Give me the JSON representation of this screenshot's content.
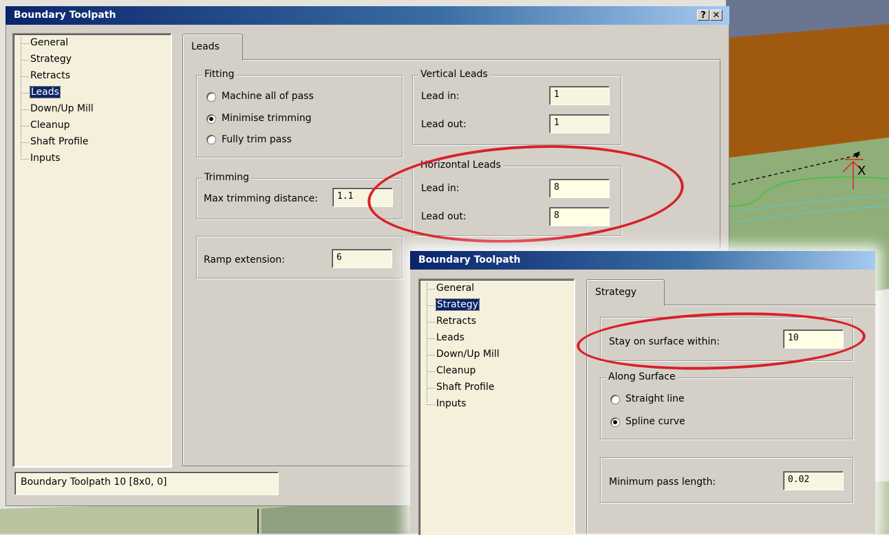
{
  "colors": {
    "titlebar": "#0a246a",
    "highlight": "#d8202a",
    "field_bg": "#f7f5e0",
    "dialog_bg": "#d4d0c8"
  },
  "main_dialog": {
    "title": "Boundary Toolpath",
    "help_button": "?",
    "close_button": "✕",
    "tree": [
      "General",
      "Strategy",
      "Retracts",
      "Leads",
      "Down/Up Mill",
      "Cleanup",
      "Shaft Profile",
      "Inputs"
    ],
    "selected_item": "Leads",
    "tab_label": "Leads",
    "fitting": {
      "label": "Fitting",
      "options": [
        "Machine all of pass",
        "Minimise trimming",
        "Fully trim pass"
      ],
      "selected": "Minimise trimming"
    },
    "vertical_leads": {
      "label": "Vertical Leads",
      "lead_in_label": "Lead in:",
      "lead_in": "1",
      "lead_out_label": "Lead out:",
      "lead_out": "1"
    },
    "trimming": {
      "label": "Trimming",
      "max_label": "Max trimming distance:",
      "max_value": "1.1"
    },
    "horizontal_leads": {
      "label": "Horizontal Leads",
      "lead_in_label": "Lead in:",
      "lead_in": "8",
      "lead_out_label": "Lead out:",
      "lead_out": "8"
    },
    "ramp": {
      "label": "Ramp extension:",
      "value": "6"
    },
    "status": "Boundary Toolpath 10 [8x0, 0]"
  },
  "strategy_dialog": {
    "title": "Boundary Toolpath",
    "tree": [
      "General",
      "Strategy",
      "Retracts",
      "Leads",
      "Down/Up Mill",
      "Cleanup",
      "Shaft Profile",
      "Inputs"
    ],
    "selected_item": "Strategy",
    "tab_label": "Strategy",
    "stay_label": "Stay on surface within:",
    "stay_value": "10",
    "along_surface": {
      "label": "Along Surface",
      "options": [
        "Straight line",
        "Spline curve"
      ],
      "selected": "Spline curve"
    },
    "min_pass_label": "Minimum pass length:",
    "min_pass_value": "0.02"
  }
}
